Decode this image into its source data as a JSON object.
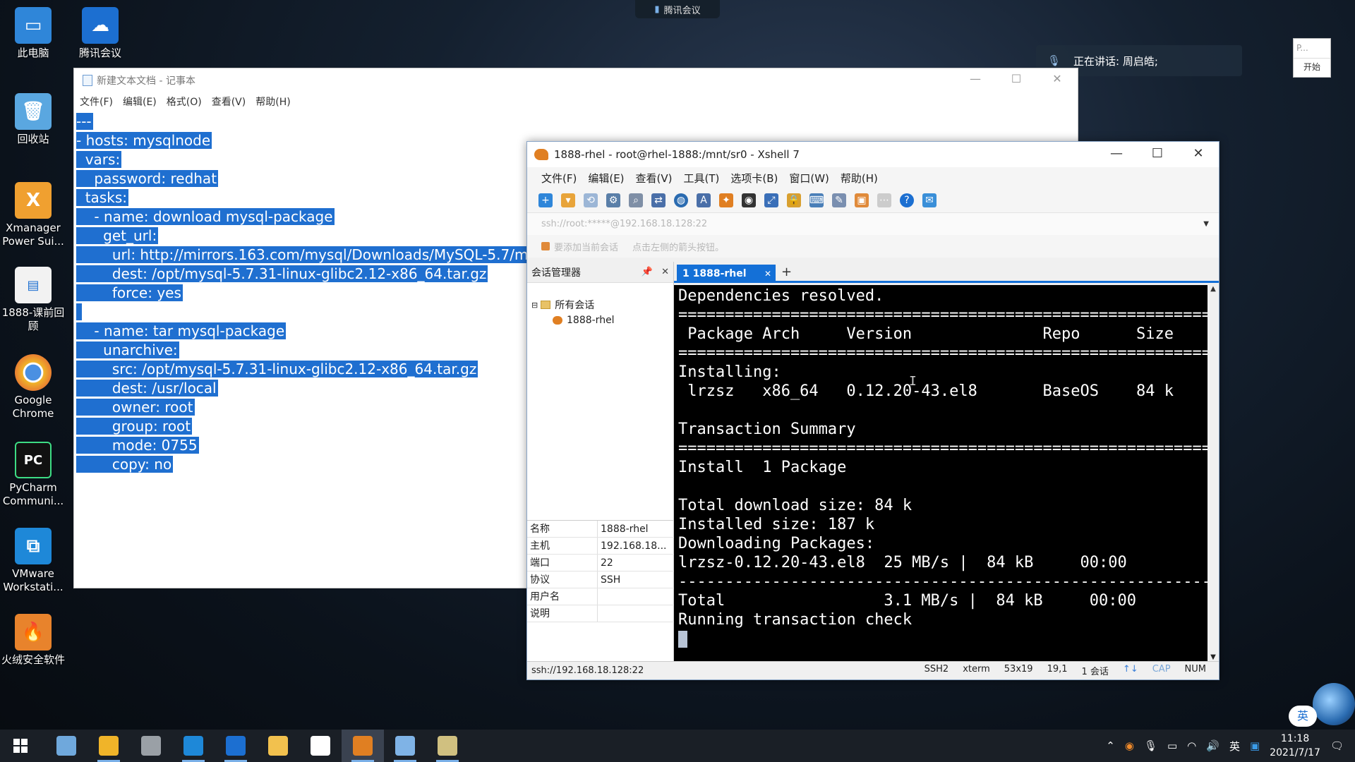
{
  "desktop": {
    "icons": [
      {
        "label": "此电脑",
        "icon": "computer-icon",
        "color": "#2f86d9"
      },
      {
        "label": "回收站",
        "icon": "recycle-bin-icon",
        "color": "#5aa7e0"
      },
      {
        "label": "Xmanager Power Sui...",
        "icon": "xmanager-icon",
        "color": "#f0a030"
      },
      {
        "label": "1888-课前回顾",
        "icon": "document-icon",
        "color": "#f2f2f2"
      },
      {
        "label": "Google Chrome",
        "icon": "chrome-icon",
        "color": "#f0b429"
      },
      {
        "label": "PyCharm Communi...",
        "icon": "pycharm-icon",
        "color": "#111111"
      },
      {
        "label": "VMware Workstati...",
        "icon": "vmware-icon",
        "color": "#1e88d8"
      },
      {
        "label": "火绒安全软件",
        "icon": "huorong-icon",
        "color": "#e8832c"
      }
    ],
    "tencent_meeting": {
      "label": "腾讯会议",
      "icon": "tencent-meeting-icon",
      "color": "#1c6fd1"
    }
  },
  "meeting": {
    "top_label": "腾讯会议",
    "speaking": "正在讲话: 周启皓;",
    "mini_placeholder": "P...",
    "mini_button": "开始"
  },
  "notepad": {
    "title": "新建文本文档 - 记事本",
    "menu": [
      "文件(F)",
      "编辑(E)",
      "格式(O)",
      "查看(V)",
      "帮助(H)"
    ],
    "lines": [
      "---",
      "- hosts: mysqlnode",
      "  vars:",
      "    password: redhat",
      "  tasks:",
      "    - name: download mysql-package",
      "      get_url:",
      "        url: http://mirrors.163.com/mysql/Downloads/MySQL-5.7/my",
      "        dest: /opt/mysql-5.7.31-linux-glibc2.12-x86_64.tar.gz",
      "        force: yes",
      " ",
      "    - name: tar mysql-package",
      "      unarchive:",
      "        src: /opt/mysql-5.7.31-linux-glibc2.12-x86_64.tar.gz",
      "        dest: /usr/local",
      "        owner: root",
      "        group: root",
      "        mode: 0755",
      "        copy: no"
    ]
  },
  "xshell": {
    "title": "1888-rhel - root@rhel-1888:/mnt/sr0 - Xshell 7",
    "menu": [
      "文件(F)",
      "编辑(E)",
      "查看(V)",
      "工具(T)",
      "选项卡(B)",
      "窗口(W)",
      "帮助(H)"
    ],
    "address": "ssh://root:*****@192.168.18.128:22",
    "hint_1": "要添加当前会话",
    "hint_2": "点击左侧的箭头按钮。",
    "session_manager": {
      "title": "会话管理器",
      "tree_root": "所有会话",
      "tree_item": "1888-rhel"
    },
    "properties": [
      {
        "key": "名称",
        "value": "1888-rhel"
      },
      {
        "key": "主机",
        "value": "192.168.18..."
      },
      {
        "key": "端口",
        "value": "22"
      },
      {
        "key": "协议",
        "value": "SSH"
      },
      {
        "key": "用户名",
        "value": ""
      },
      {
        "key": "说明",
        "value": ""
      }
    ],
    "tab_label": "1 1888-rhel",
    "terminal_lines": [
      "Dependencies resolved.",
      "=================================================================",
      " Package Arch     Version              Repo      Size",
      "=================================================================",
      "Installing:",
      " lrzsz   x86_64   0.12.20-43.el8       BaseOS    84 k",
      "",
      "Transaction Summary",
      "=================================================================",
      "Install  1 Package",
      "",
      "Total download size: 84 k",
      "Installed size: 187 k",
      "Downloading Packages:",
      "lrzsz-0.12.20-43.el8  25 MB/s |  84 kB     00:00",
      "-----------------------------------------------------------------",
      "Total                 3.1 MB/s |  84 kB     00:00",
      "Running transaction check"
    ],
    "status": {
      "url": "ssh://192.168.18.128:22",
      "protocol": "SSH2",
      "term": "xterm",
      "size": "53x19",
      "pos": "19,1",
      "sessions": "1 会话",
      "cap": "CAP",
      "num": "NUM"
    }
  },
  "taskbar": {
    "apps": [
      {
        "icon": "xmanager-taskbar-icon",
        "color": "#6fa8dc"
      },
      {
        "icon": "chrome-taskbar-icon",
        "color": "#f0b429"
      },
      {
        "icon": "wechat-taskbar-icon",
        "color": "#9aa0a6"
      },
      {
        "icon": "vmware-taskbar-icon",
        "color": "#1e88d8"
      },
      {
        "icon": "tencent-meeting-taskbar-icon",
        "color": "#1c6fd1"
      },
      {
        "icon": "file-explorer-taskbar-icon",
        "color": "#f2c14e"
      },
      {
        "icon": "typora-taskbar-icon",
        "color": "#ffffff"
      },
      {
        "icon": "xshell-taskbar-icon",
        "color": "#e07f22"
      },
      {
        "icon": "notepad-taskbar-icon",
        "color": "#7fb3e6"
      },
      {
        "icon": "xftp-taskbar-icon",
        "color": "#d0c080"
      }
    ],
    "ime": "英",
    "time": "11:18",
    "date": "2021/7/17"
  }
}
